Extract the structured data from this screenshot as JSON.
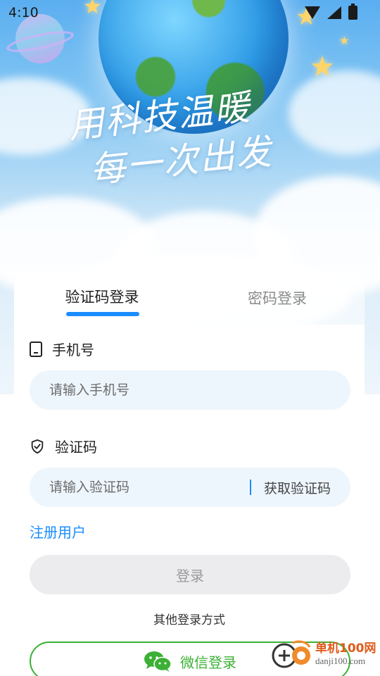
{
  "status_bar": {
    "time": "4:10"
  },
  "hero": {
    "slogan_line1": "用科技温暖",
    "slogan_line2": "每一次出发"
  },
  "tabs": [
    {
      "label": "验证码登录",
      "active": true
    },
    {
      "label": "密码登录",
      "active": false
    }
  ],
  "phone_field": {
    "label": "手机号",
    "placeholder": "请输入手机号",
    "icon": "phone-icon"
  },
  "code_field": {
    "label": "验证码",
    "placeholder": "请输入验证码",
    "get_code_label": "获取验证码",
    "icon": "shield-check-icon"
  },
  "register_link": "注册用户",
  "login_button": "登录",
  "other_login": {
    "label": "其他登录方式",
    "wechat_label": "微信登录"
  },
  "watermark": {
    "name": "单机100网",
    "domain": "danji100.com"
  },
  "colors": {
    "accent": "#1a8cff",
    "wechat": "#3cb035",
    "input_bg": "#eef6fd"
  }
}
